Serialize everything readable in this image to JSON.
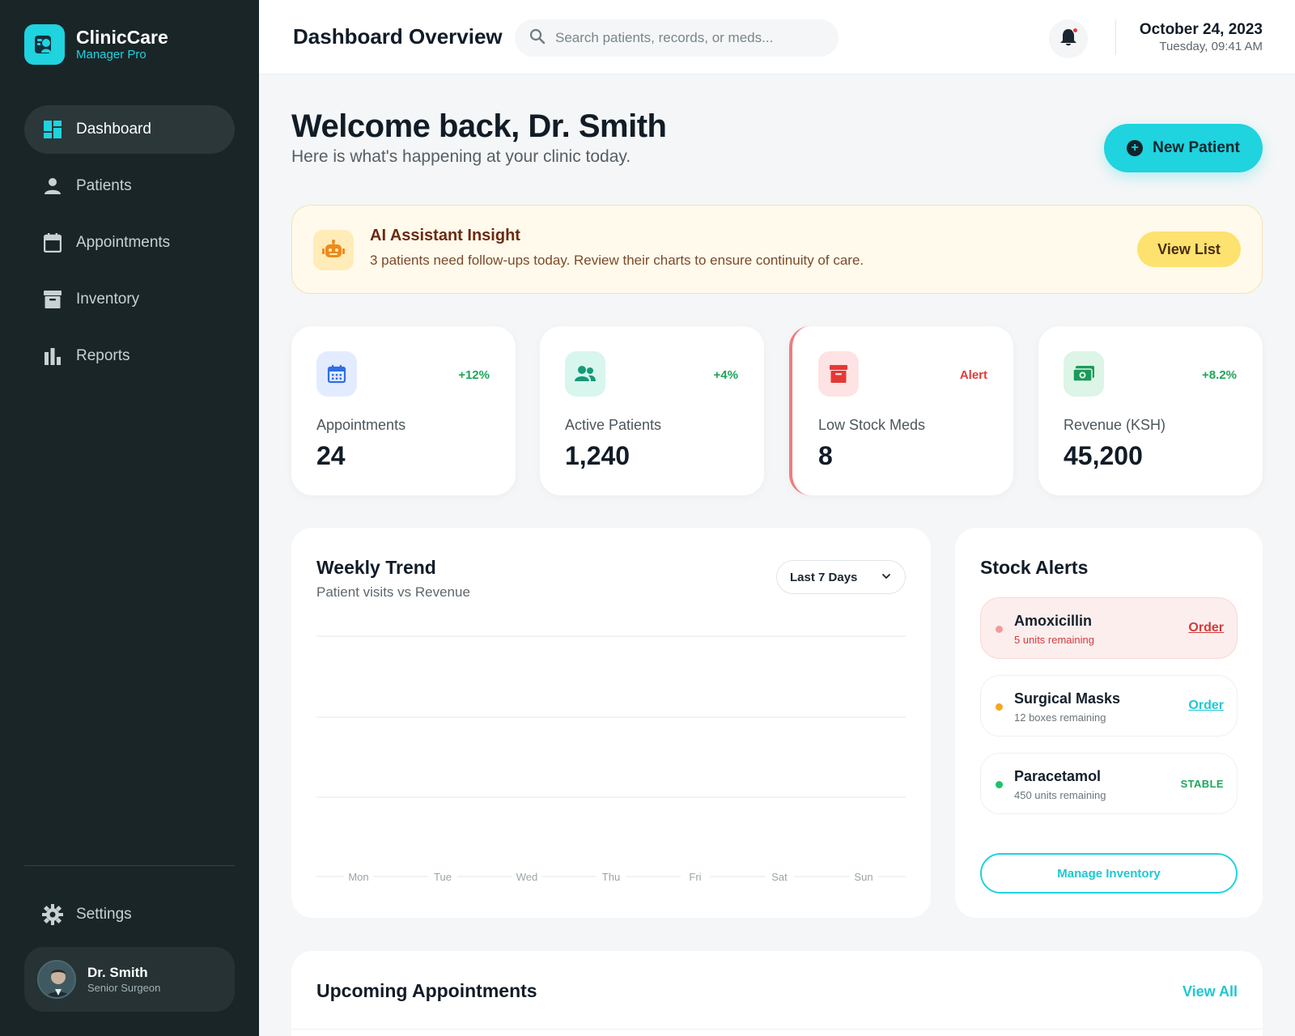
{
  "brand": {
    "name": "ClinicCare",
    "subtitle": "Manager Pro",
    "logo_icon": "clinic-logo-icon"
  },
  "sidebar": {
    "items": [
      {
        "label": "Dashboard",
        "icon": "dashboard-icon",
        "active": true
      },
      {
        "label": "Patients",
        "icon": "person-icon",
        "active": false
      },
      {
        "label": "Appointments",
        "icon": "calendar-icon",
        "active": false
      },
      {
        "label": "Inventory",
        "icon": "archive-icon",
        "active": false
      },
      {
        "label": "Reports",
        "icon": "bar-chart-icon",
        "active": false
      }
    ],
    "settings_label": "Settings",
    "user": {
      "name": "Dr. Smith",
      "role": "Senior Surgeon"
    }
  },
  "header": {
    "title": "Dashboard Overview",
    "search_placeholder": "Search patients, records, or meds...",
    "date": "October 24, 2023",
    "day_time": "Tuesday, 09:41 AM"
  },
  "welcome": {
    "title": "Welcome back, Dr. Smith",
    "subtitle": "Here is what's happening at your clinic today.",
    "new_patient_label": "New Patient"
  },
  "insight": {
    "title": "AI Assistant Insight",
    "text": "3 patients need follow-ups today. Review their charts to ensure continuity of care.",
    "button_label": "View List"
  },
  "stats": [
    {
      "label": "Appointments",
      "value": "24",
      "badge": "+12%",
      "badge_color": "#1ea65a",
      "icon": "calendar-icon",
      "icon_bg": "#e3ecff",
      "icon_color": "#2f6fe4"
    },
    {
      "label": "Active Patients",
      "value": "1,240",
      "badge": "+4%",
      "badge_color": "#1ea65a",
      "icon": "people-icon",
      "icon_bg": "#d8f6ee",
      "icon_color": "#159a7a"
    },
    {
      "label": "Low Stock Meds",
      "value": "8",
      "badge": "Alert",
      "badge_color": "#e53935",
      "icon": "archive-icon",
      "icon_bg": "#fde3e3",
      "icon_color": "#e53935"
    },
    {
      "label": "Revenue (KSH)",
      "value": "45,200",
      "badge": "+8.2%",
      "badge_color": "#1ea65a",
      "icon": "cash-icon",
      "icon_bg": "#dcf5e6",
      "icon_color": "#1a9a5c"
    }
  ],
  "trend": {
    "title": "Weekly Trend",
    "subtitle": "Patient visits vs Revenue",
    "range_label": "Last 7 Days"
  },
  "chart_data": {
    "type": "line",
    "categories": [
      "Mon",
      "Tue",
      "Wed",
      "Thu",
      "Fri",
      "Sat",
      "Sun"
    ],
    "series": [],
    "title": "Weekly Trend",
    "subtitle": "Patient visits vs Revenue",
    "grid": true
  },
  "stock": {
    "title": "Stock Alerts",
    "items": [
      {
        "name": "Amoxicillin",
        "qty": "5 units remaining",
        "action": "Order",
        "status": "critical",
        "dot_color": "#f29b9b",
        "qty_color": "#d23b3b",
        "action_color": "#d23b3b"
      },
      {
        "name": "Surgical Masks",
        "qty": "12 boxes remaining",
        "action": "Order",
        "status": "warning",
        "dot_color": "#f5a623",
        "qty_color": "#6b757b",
        "action_color": "#1fc7d3"
      },
      {
        "name": "Paracetamol",
        "qty": "450 units remaining",
        "action": "STABLE",
        "status": "stable",
        "dot_color": "#1ec26a",
        "qty_color": "#6b757b",
        "action_color": "#1ea65a"
      }
    ],
    "manage_label": "Manage Inventory"
  },
  "upcoming": {
    "title": "Upcoming Appointments",
    "view_all_label": "View All"
  },
  "colors": {
    "accent": "#1fd3df",
    "sidebar_bg": "#1a2528",
    "alert": "#e53935",
    "success": "#1ea65a"
  }
}
